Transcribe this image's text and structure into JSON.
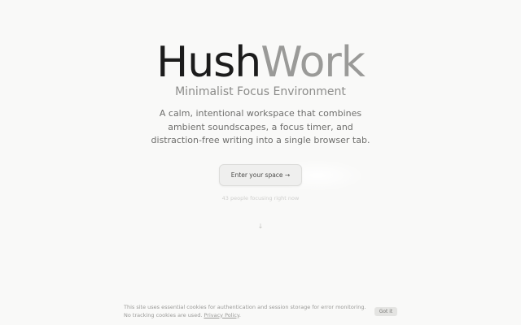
{
  "hero": {
    "logo_primary": "Hush",
    "logo_secondary": "Work",
    "subtitle": "Minimalist Focus Environment",
    "description_lines": [
      "A calm, intentional workspace that combines",
      "ambient soundscapes, a focus timer, and",
      "distraction-free writing into a single browser tab."
    ],
    "cta_label": "Enter your space →",
    "focus_count_text": "43 people focusing right now",
    "scroll_indicator": "↓"
  },
  "cookie_banner": {
    "text": "This site uses essential cookies for authentication and session storage for error monitoring. No tracking cookies are used.",
    "link_label": "Privacy Policy",
    "link_suffix": ".",
    "accept_label": "Got it"
  },
  "colors": {
    "background": "#f9f9f8",
    "logo_dark": "#1c1c1c",
    "logo_light": "#9a9a98",
    "button_bg": "#efefee"
  }
}
